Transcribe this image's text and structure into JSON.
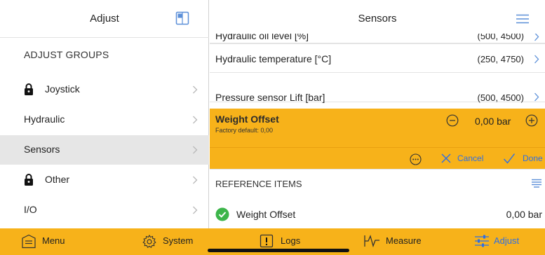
{
  "left": {
    "title": "Adjust",
    "group_heading": "ADJUST GROUPS",
    "items": [
      {
        "label": "Joystick",
        "locked": true,
        "selected": false
      },
      {
        "label": "Hydraulic",
        "locked": false,
        "selected": false
      },
      {
        "label": "Sensors",
        "locked": false,
        "selected": true
      },
      {
        "label": "Other",
        "locked": true,
        "selected": false
      },
      {
        "label": "I/O",
        "locked": false,
        "selected": false
      }
    ]
  },
  "right": {
    "title": "Sensors",
    "rows": [
      {
        "name": "Hydraulic oil level [%]",
        "value": "(500, 4500)"
      },
      {
        "name": "Hydraulic temperature [°C]",
        "value": "(250, 4750)"
      },
      {
        "name": "Pressure sensor Lift [bar]",
        "value": "(500, 4500)"
      }
    ],
    "edit": {
      "title": "Weight Offset",
      "subtitle": "Factory default: 0,00",
      "value": "0,00 bar",
      "cancel_label": "Cancel",
      "done_label": "Done"
    },
    "reference": {
      "heading": "REFERENCE ITEMS",
      "item_label": "Weight Offset",
      "item_value": "0,00 bar"
    }
  },
  "tabbar": {
    "tabs": [
      {
        "label": "Menu",
        "icon": "menu-icon"
      },
      {
        "label": "System",
        "icon": "gear-icon"
      },
      {
        "label": "Logs",
        "icon": "logs-icon"
      },
      {
        "label": "Measure",
        "icon": "measure-icon"
      },
      {
        "label": "Adjust",
        "icon": "sliders-icon",
        "active": true
      }
    ]
  },
  "colors": {
    "accent": "#f7b21a",
    "link": "#2d6fe6",
    "ok_green": "#3cb54a"
  }
}
